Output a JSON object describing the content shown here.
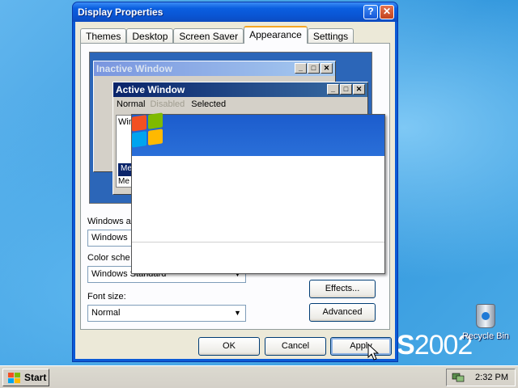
{
  "dialog": {
    "title": "Display Properties",
    "help_glyph": "?",
    "close_glyph": "✕",
    "tabs": [
      {
        "label": "Themes",
        "active": false
      },
      {
        "label": "Desktop",
        "active": false
      },
      {
        "label": "Screen Saver",
        "active": false
      },
      {
        "label": "Appearance",
        "active": true
      },
      {
        "label": "Settings",
        "active": false
      }
    ]
  },
  "preview": {
    "inactive_title": "Inactive Window",
    "active_title": "Active Window",
    "menu_normal": "Normal",
    "menu_disabled": "Disabled",
    "menu_selected": "Selected",
    "window_text": "Win",
    "message_box_title": "Me",
    "message_text": "Me"
  },
  "appearance": {
    "windows_label": "Windows a",
    "windows_value": "Windows",
    "color_label": "Color sche",
    "color_value": "Windows Standard",
    "font_label": "Font size:",
    "font_value": "Normal",
    "effects_label": "Effects...",
    "advanced_label": "Advanced"
  },
  "buttons": {
    "ok": "OK",
    "cancel": "Cancel",
    "apply": "Apply"
  },
  "desktop": {
    "recycle_bin_label": "Recycle Bin",
    "brand_text": "S",
    "brand_year": "2002"
  },
  "taskbar": {
    "start_label": "Start",
    "clock": "2:32 PM"
  },
  "colors": {
    "title_blue": "#0a5ad6",
    "dialog_face": "#ece9d8",
    "desktop_blue": "#3a9fe0"
  }
}
